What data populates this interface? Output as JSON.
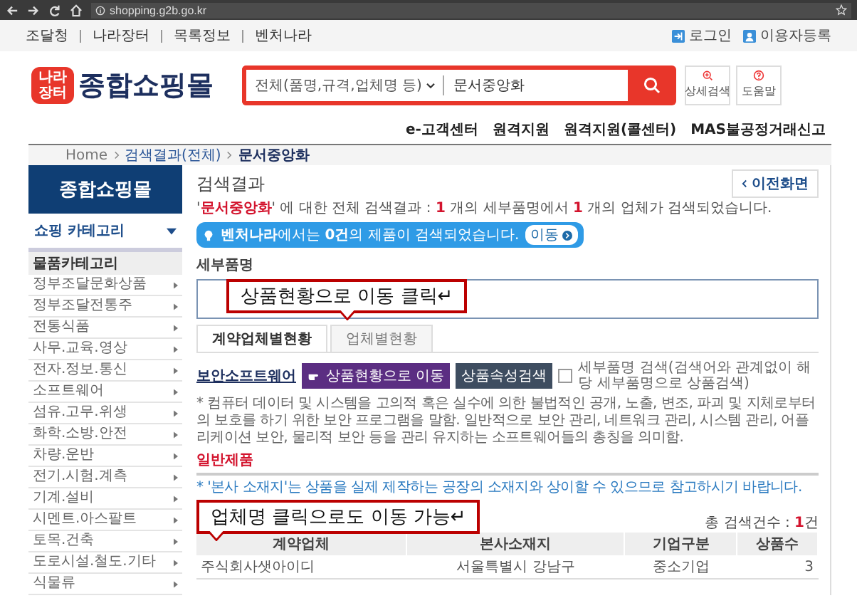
{
  "browser": {
    "url": "shopping.g2b.go.kr"
  },
  "top_links": [
    "조달청",
    "나라장터",
    "목록정보",
    "벤처나라"
  ],
  "account_links": [
    {
      "label": "로그인",
      "kind": "login"
    },
    {
      "label": "이용자등록",
      "kind": "user"
    }
  ],
  "logo": {
    "badge": "나라장터",
    "text": "종합쇼핑몰"
  },
  "search": {
    "scope": "전체(품명,규격,업체명 등)",
    "value": "문서중앙화"
  },
  "header_buttons": [
    {
      "label": "상세검색",
      "kind": "zoom"
    },
    {
      "label": "도움말",
      "kind": "help"
    }
  ],
  "nav_links": [
    "e-고객센터",
    "원격지원",
    "원격지원(콜센터)",
    "MAS불공정거래신고"
  ],
  "breadcrumb": [
    "Home",
    "검색결과(전체)",
    "문서중앙화"
  ],
  "sidebar": {
    "title": "종합쇼핑몰",
    "menu": "쇼핑 카테고리",
    "section": "물품카테고리",
    "items": [
      "정부조달문화상품",
      "정부조달전통주",
      "전통식품",
      "사무.교육.영상",
      "전자.정보.통신",
      "소프트웨어",
      "섬유.고무.위생",
      "화학.소방.안전",
      "차량.운반",
      "전기.시험.계측",
      "기계.설비",
      "시멘트.아스팔트",
      "토목.건축",
      "도로시설.철도.기타",
      "식물류"
    ]
  },
  "main": {
    "title": "검색결과",
    "back_button": "이전화면",
    "summary": "'**문서중앙화**' 에 대한 전체 검색결과 : **1** 개의 세부품명에서 **1** 개의 업체가 검색되었습니다.",
    "venture_notice": "**벤처나라**에서는 **0건**의 제품이 검색되었습니다.",
    "venture_button": "이동",
    "detail_label": "세부품명",
    "tabs": [
      {
        "label": "계약업체별현황",
        "selected": true
      },
      {
        "label": "업체별현황",
        "selected": false
      }
    ],
    "product": {
      "name": "보안소프트웨어",
      "goto_button": "상품현황으로 이동",
      "attr_button": "상품속성검색",
      "checkbox_label": "세부품명 검색(검색어와 관계없이 해당 세부품명으로 상품검색)",
      "checked": false
    },
    "description": "* 컴퓨터 데이터 및 시스템을 고의적 혹은 실수에 의한 불법적인 공개, 노출, 변조, 파괴 및 지체로부터의 보호를 하기 위한 보안 프로그램을 말함. 일반적으로 보안 관리, 네트워크 관리, 시스템 관리, 어플리케이션 보안, 물리적 보안 등을 관리 유지하는 소프트웨어들의 총칭을 의미함.",
    "category": "일반제품",
    "note": "* '본사 소재지'는 상품을 실제 제작하는 공장의 소재지와 상이할 수 있으므로 참고하시기 바랍니다.",
    "total": "총 검색건수 : **1**건",
    "table": {
      "columns": [
        "계약업체",
        "본사소재지",
        "기업구분",
        "상품수"
      ],
      "rows": [
        [
          "주식회사샛아이디",
          "서울특별시 강남구",
          "중소기업",
          "3"
        ]
      ]
    }
  },
  "callouts": [
    "상품현황으로 이동 클릭↵",
    "업체명 클릭으로도 이동 가능↵"
  ]
}
